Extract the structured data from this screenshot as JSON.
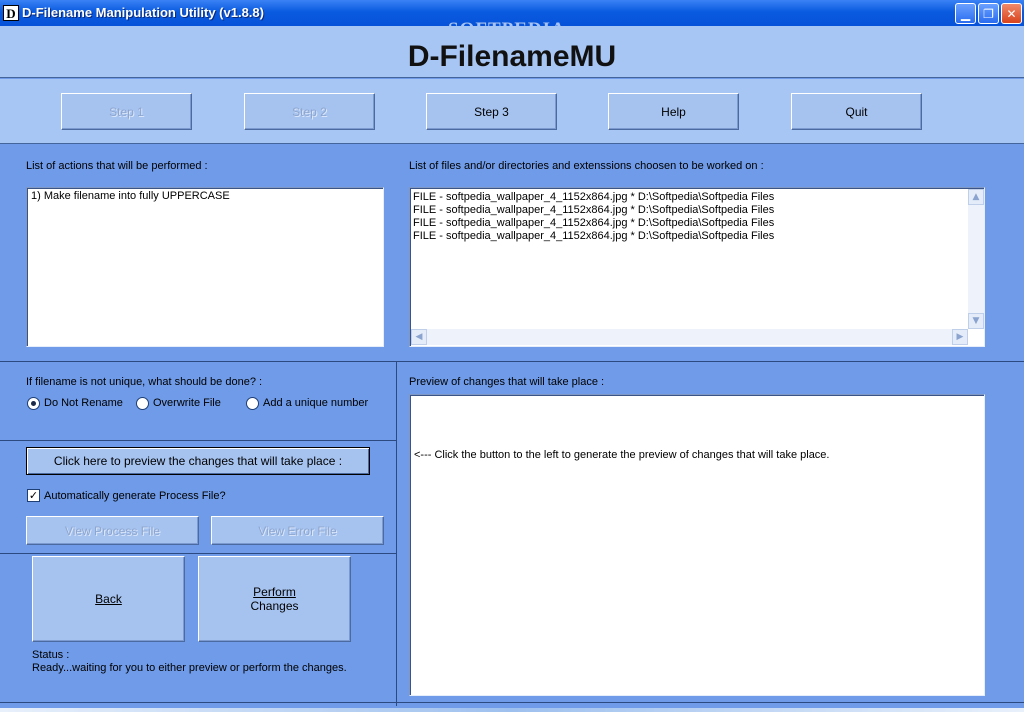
{
  "window": {
    "title": "D-Filename Manipulation Utility (v1.8.8)",
    "icon_letter": "D",
    "controls": {
      "minimize": "▁",
      "restore": "❐",
      "close": "✕"
    },
    "watermark": "SOFTPEDIA"
  },
  "header": {
    "app_name": "D-FilenameMU"
  },
  "steps": [
    {
      "label": "Step 1",
      "enabled": false
    },
    {
      "label": "Step 2",
      "enabled": false
    },
    {
      "label": "Step 3",
      "enabled": true
    },
    {
      "label": "Help",
      "enabled": true
    },
    {
      "label": "Quit",
      "enabled": true
    }
  ],
  "actions_panel": {
    "label": "List of actions that will be performed :",
    "items": [
      "1) Make filename into fully UPPERCASE"
    ]
  },
  "files_panel": {
    "label": "List of files and/or directories and extenssions choosen to be worked on :",
    "items": [
      "FILE - softpedia_wallpaper_4_1152x864.jpg * D:\\Softpedia\\Softpedia Files",
      "FILE - softpedia_wallpaper_4_1152x864.jpg * D:\\Softpedia\\Softpedia Files",
      "FILE - softpedia_wallpaper_4_1152x864.jpg * D:\\Softpedia\\Softpedia Files",
      "FILE - softpedia_wallpaper_4_1152x864.jpg * D:\\Softpedia\\Softpedia Files"
    ]
  },
  "unique": {
    "label": "If filename is not unique, what should be done? :",
    "options": [
      "Do Not Rename",
      "Overwrite File",
      "Add a unique number"
    ],
    "selected": "Do Not Rename"
  },
  "preview_button": {
    "label": "Click here to preview the changes that will take place :"
  },
  "auto_process": {
    "label": "Automatically generate Process File?",
    "checked": true
  },
  "view_process_button": {
    "label": "View Process File"
  },
  "view_error_button": {
    "label": "View Error File"
  },
  "back_button": {
    "label": "Back"
  },
  "perform_button": {
    "line1": "Perform",
    "line2": "Changes"
  },
  "status": {
    "label": "Status :",
    "text": "Ready...waiting for you to either preview or perform the changes."
  },
  "preview_panel": {
    "label": "Preview of changes that will take place :",
    "text": "<--- Click the button to the left to generate the preview of changes that will take place."
  }
}
